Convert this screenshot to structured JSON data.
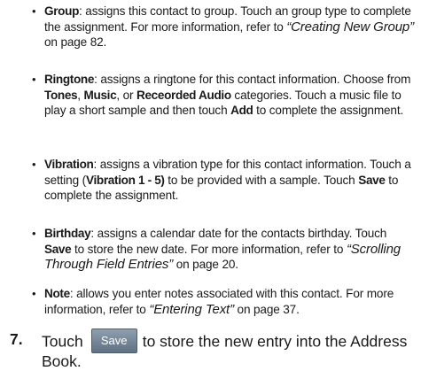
{
  "items": {
    "group": {
      "term": "Group",
      "text1": ": assigns this contact to group. Touch an group type to complete the assignment. For more information, refer to ",
      "ref": "“Creating New Group”",
      "text2": " on page 82."
    },
    "ringtone": {
      "term": "Ringtone",
      "text1": ": assigns a ringtone for this contact information. Choose from ",
      "opt1": "Tones",
      "sep1": ", ",
      "opt2": "Music",
      "sep2": ", or ",
      "opt3": "Receorded Audio",
      "text2": " categories. Touch a music file to play a short sample and then touch ",
      "action": "Add",
      "text3": " to complete the assignment."
    },
    "vibration": {
      "term": "Vibration",
      "text1": ": assigns a vibration type for this contact information. Touch a setting (",
      "setting": "Vibration 1 - 5)",
      "text2": " to be provided with a sample. Touch ",
      "action": "Save",
      "text3": " to complete the assignment."
    },
    "birthday": {
      "term": "Birthday",
      "text1": ": assigns a calendar date for the contacts birthday. Touch ",
      "action": "Save",
      "text2": " to store the new date. For more information, refer to ",
      "ref": "“Scrolling Through Field Entries”",
      "text3": " on page 20."
    },
    "note": {
      "term": "Note",
      "text1": ": allows you enter notes associated with this contact. For more information, refer to ",
      "ref": "“Entering Text”",
      "text2": " on page 37."
    }
  },
  "bullet_glyph": "•",
  "step": {
    "number": "7.",
    "before": "Touch",
    "button_label": "Save",
    "after": "to store the new entry into the Address",
    "line2": "Book."
  }
}
